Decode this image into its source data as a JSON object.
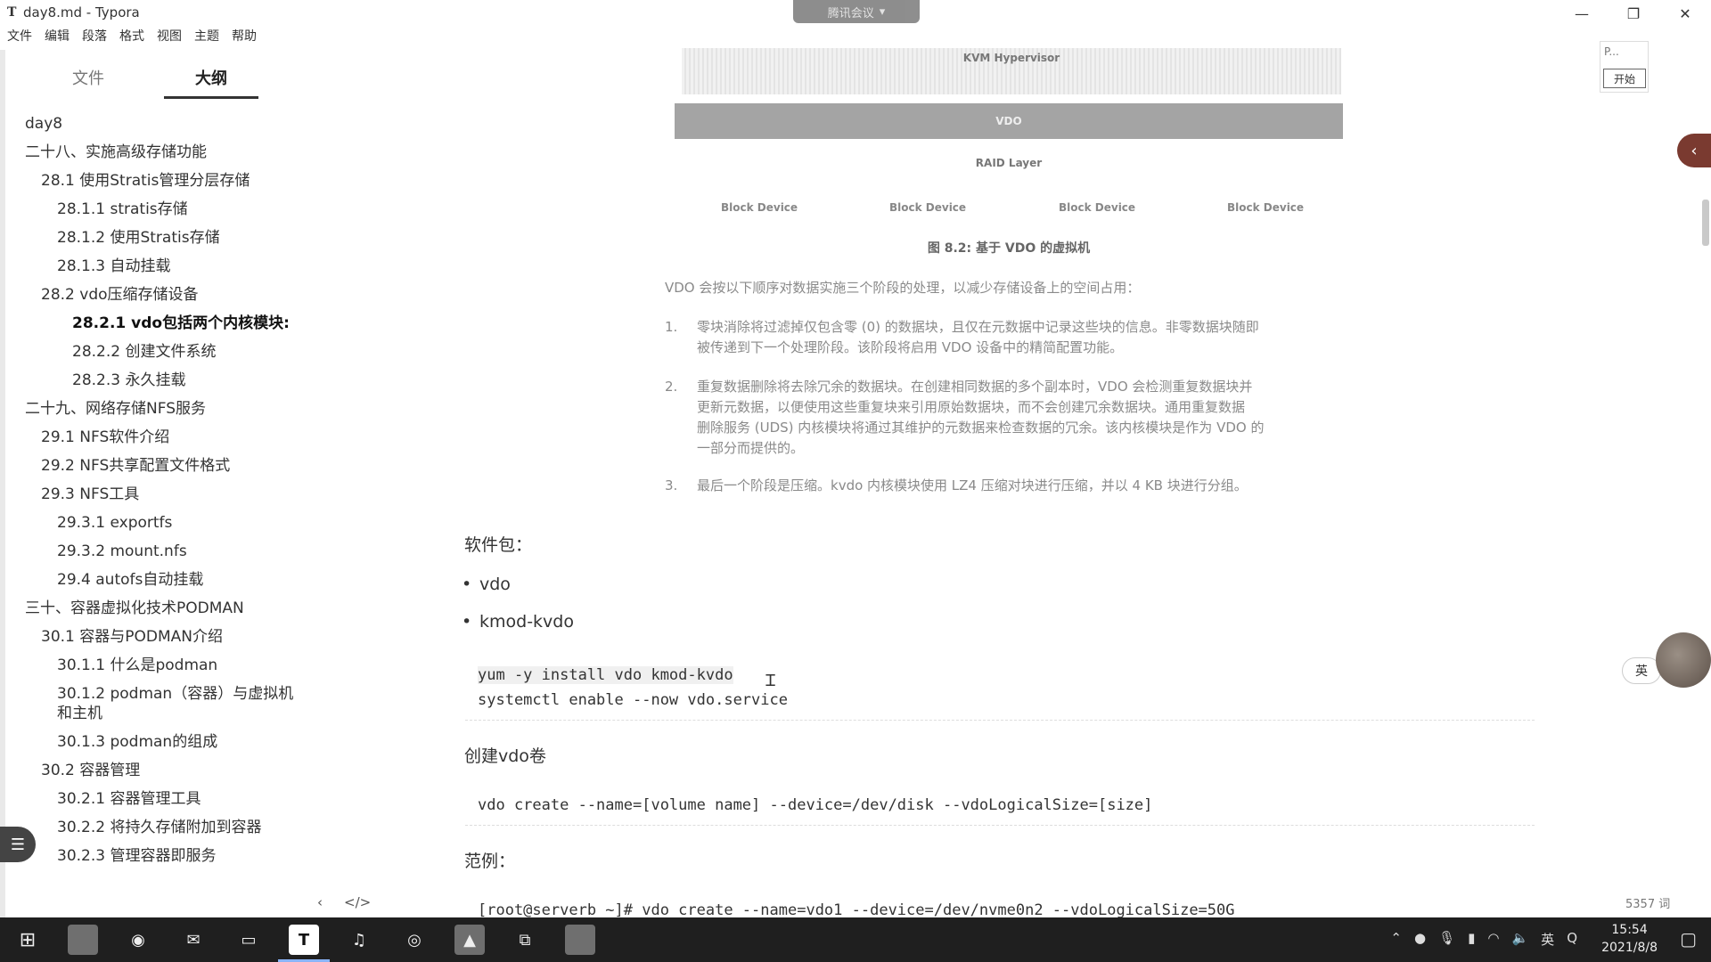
{
  "window": {
    "app_icon": "T",
    "title": "day8.md - Typora",
    "controls": [
      "—",
      "❐",
      "✕"
    ],
    "meeting_label": "腾讯会议"
  },
  "menu": [
    "文件",
    "编辑",
    "段落",
    "格式",
    "视图",
    "主题",
    "帮助"
  ],
  "sidebar": {
    "tabs": [
      "文件",
      "大纲"
    ],
    "outline": [
      {
        "label": "day8",
        "level": 0
      },
      {
        "label": "二十八、实施高级存储功能",
        "level": 0
      },
      {
        "label": "28.1 使用Stratis管理分层存储",
        "level": 1
      },
      {
        "label": "28.1.1 stratis存储",
        "level": 2
      },
      {
        "label": "28.1.2 使用Stratis存储",
        "level": 2
      },
      {
        "label": "28.1.3 自动挂载",
        "level": 2
      },
      {
        "label": "28.2 vdo压缩存储设备",
        "level": 1
      },
      {
        "label": "28.2.1 vdo包括两个内核模块:",
        "level": 3,
        "active": true
      },
      {
        "label": "28.2.2 创建文件系统",
        "level": 3
      },
      {
        "label": "28.2.3 永久挂载",
        "level": 3
      },
      {
        "label": "二十九、网络存储NFS服务",
        "level": 0
      },
      {
        "label": "29.1 NFS软件介绍",
        "level": 1
      },
      {
        "label": "29.2 NFS共享配置文件格式",
        "level": 1
      },
      {
        "label": "29.3 NFS工具",
        "level": 1
      },
      {
        "label": "29.3.1 exportfs",
        "level": 2
      },
      {
        "label": "29.3.2 mount.nfs",
        "level": 2
      },
      {
        "label": "29.4 autofs自动挂载",
        "level": 2
      },
      {
        "label": "三十、容器虚拟化技术PODMAN",
        "level": 0
      },
      {
        "label": "30.1 容器与PODMAN介绍",
        "level": 1
      },
      {
        "label": "30.1.1 什么是podman",
        "level": 2
      },
      {
        "label": "30.1.2 podman（容器）与虚拟机和主机",
        "level": 2
      },
      {
        "label": "30.1.3 podman的组成",
        "level": 2
      },
      {
        "label": "30.2 容器管理",
        "level": 1
      },
      {
        "label": "30.2.1 容器管理工具",
        "level": 2
      },
      {
        "label": "30.2.2 将持久存储附加到容器",
        "level": 2
      },
      {
        "label": "30.2.3 管理容器即服务",
        "level": 2
      }
    ],
    "footer_left": "‹",
    "footer_right": "</>"
  },
  "figure": {
    "hypervisor": "KVM Hypervisor",
    "vdo": "VDO",
    "raid": "RAID Layer",
    "block_devices": [
      "Block Device",
      "Block Device",
      "Block Device",
      "Block Device"
    ],
    "caption": "图 8.2: 基于 VDO 的虚拟机"
  },
  "article": {
    "intro": "VDO 会按以下顺序对数据实施三个阶段的处理，以减少存储设备上的空间占用：",
    "steps": [
      {
        "num": "1.",
        "lines": [
          "零块消除将过滤掉仅包含零 (0) 的数据块，且仅在元数据中记录这些块的信息。非零数据块随即",
          "被传递到下一个处理阶段。该阶段将启用 VDO 设备中的精简配置功能。"
        ]
      },
      {
        "num": "2.",
        "lines": [
          "重复数据删除将去除冗余的数据块。在创建相同数据的多个副本时，VDO 会检测重复数据块并",
          "更新元数据，以便使用这些重复块来引用原始数据块，而不会创建冗余数据块。通用重复数据",
          "删除服务 (UDS) 内核模块将通过其维护的元数据来检查数据的冗余。该内核模块是作为 VDO 的",
          "一部分而提供的。"
        ]
      },
      {
        "num": "3.",
        "lines": [
          "最后一个阶段是压缩。kvdo 内核模块使用 LZ4 压缩对块进行压缩，并以 4 KB 块进行分组。"
        ]
      }
    ],
    "packages_heading": "软件包：",
    "packages": [
      "vdo",
      "kmod-kvdo"
    ],
    "code1": [
      "yum -y install vdo kmod-kvdo",
      "systemctl enable --now vdo.service"
    ],
    "create_heading": "创建vdo卷",
    "code2": "vdo create --name=[volume name] --device=/dev/disk --vdoLogicalSize=[size]",
    "example_heading": "范例：",
    "code3": "[root@serverb ~]# vdo create --name=vdo1 --device=/dev/nvme0n2 --vdoLogicalSize=50G"
  },
  "right_panel": {
    "p": "P...",
    "start": "开始"
  },
  "ime": "英",
  "word_count": "5357 词",
  "taskbar": {
    "time": "15:54",
    "date": "2021/8/8",
    "tray_lang": "英"
  }
}
